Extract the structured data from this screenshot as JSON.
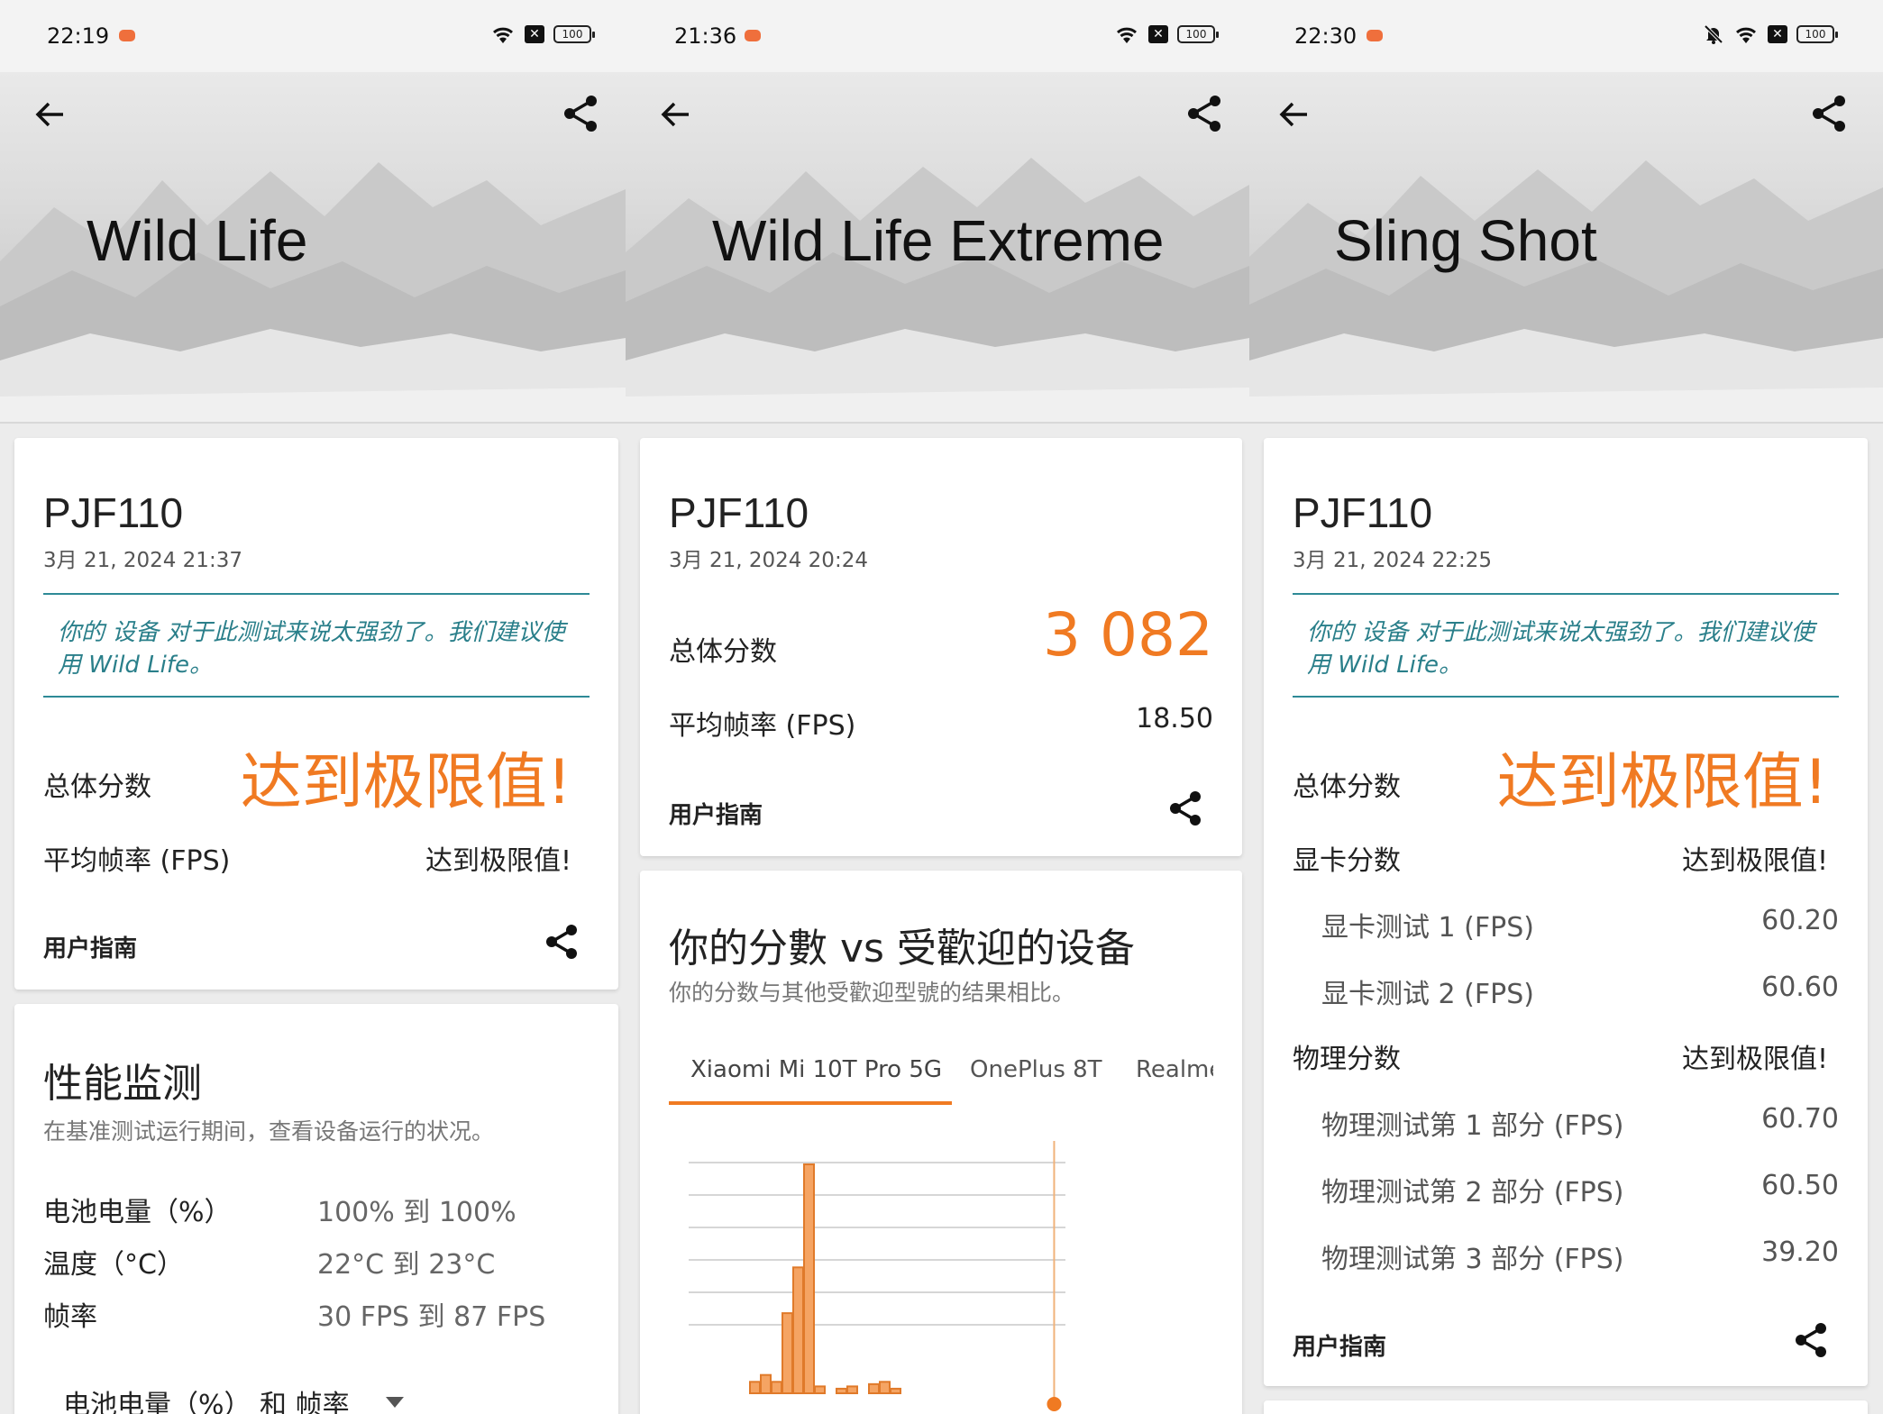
{
  "screens": [
    {
      "status": {
        "time": "22:19",
        "battery": "100"
      },
      "title": "Wild Life",
      "result": {
        "device": "PJF110",
        "date": "3月 21, 2024 21:37",
        "note": "你的 设备 对于此测试来说太强劲了。我们建议使用 Wild Life。",
        "overall_label": "总体分数",
        "overall_value": "达到极限值!",
        "fps_label": "平均帧率 (FPS)",
        "fps_value": "达到极限值!",
        "guide": "用户指南"
      },
      "monitor": {
        "title": "性能监测",
        "desc": "在基准测试运行期间，查看设备运行的状况。",
        "rows": [
          {
            "label": "电池电量（%）",
            "value": "100% 到 100%"
          },
          {
            "label": "温度（°C）",
            "value": "22°C 到 23°C"
          },
          {
            "label": "帧率",
            "value": "30 FPS 到 87 FPS"
          }
        ],
        "dropdown": "电池电量（%） 和 帧率"
      }
    },
    {
      "status": {
        "time": "21:36",
        "battery": "100"
      },
      "title": "Wild Life Extreme",
      "result": {
        "device": "PJF110",
        "date": "3月 21, 2024 20:24",
        "overall_label": "总体分数",
        "overall_value": "3 082",
        "fps_label": "平均帧率 (FPS)",
        "fps_value": "18.50",
        "guide": "用户指南"
      },
      "compare": {
        "title": "你的分數 vs 受歡迎的设备",
        "desc": "你的分数与其他受歡迎型號的结果相比。",
        "tabs": [
          "Xiaomi Mi 10T Pro 5G",
          "OnePlus 8T",
          "Realme"
        ]
      }
    },
    {
      "status": {
        "time": "22:30",
        "battery": "100"
      },
      "title": "Sling Shot",
      "result": {
        "device": "PJF110",
        "date": "3月 21, 2024 22:25",
        "note": "你的 设备 对于此测试来说太强劲了。我们建议使用 Wild Life。",
        "overall_label": "总体分数",
        "overall_value": "达到极限值!",
        "graphics_label": "显卡分数",
        "graphics_value": "达到极限值!",
        "graphics_tests": [
          {
            "label": "显卡测试 1 (FPS)",
            "value": "60.20"
          },
          {
            "label": "显卡测试 2 (FPS)",
            "value": "60.60"
          }
        ],
        "physics_label": "物理分数",
        "physics_value": "达到极限值!",
        "physics_tests": [
          {
            "label": "物理测试第 1 部分 (FPS)",
            "value": "60.70"
          },
          {
            "label": "物理测试第 2 部分 (FPS)",
            "value": "60.50"
          },
          {
            "label": "物理测试第 3 部分 (FPS)",
            "value": "39.20"
          }
        ],
        "guide": "用户指南"
      }
    }
  ],
  "colors": {
    "accent": "#f07a22",
    "note": "#2a7f8a",
    "divider": "#2e8a96"
  },
  "icons": [
    "back-arrow-icon",
    "share-icon",
    "wifi-icon",
    "sim-x-icon",
    "battery-icon",
    "bell-muted-icon",
    "dropdown-arrow-icon"
  ],
  "chart_data": {
    "type": "bar",
    "title": "",
    "xlabel": "",
    "ylabel": "",
    "gridlines": 6,
    "grid": true,
    "values": [
      0.05,
      0.08,
      0.05,
      0.35,
      0.55,
      1.0,
      0.03,
      0.0,
      0.02,
      0.03,
      0.0,
      0.04,
      0.05,
      0.02
    ],
    "marker_fraction": 0.97
  }
}
